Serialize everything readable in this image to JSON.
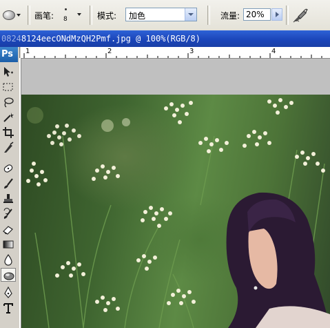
{
  "options_bar": {
    "tool_icon": "blur-tool-icon",
    "brush_label": "画笔:",
    "brush_size": "8",
    "mode_label": "模式:",
    "mode_value": "加色",
    "flow_label": "流量:",
    "flow_value": "20%",
    "airbrush_icon": "airbrush-icon"
  },
  "document": {
    "title_prefix": "0824",
    "title": "8124eecONdMzQH2Pmf.jpg @ 100%(RGB/8)"
  },
  "tools_panel": {
    "logo": "Ps",
    "tools": [
      "move-tool-icon",
      "marquee-tool-icon",
      "lasso-tool-icon",
      "magic-wand-icon",
      "crop-tool-icon",
      "slice-tool-icon",
      "healing-brush-icon",
      "brush-tool-icon",
      "clone-stamp-icon",
      "history-brush-icon",
      "eraser-icon",
      "gradient-icon",
      "blur-tool-icon",
      "dodge-tool-icon",
      "pen-tool-icon",
      "type-tool-icon"
    ]
  },
  "ruler": {
    "labels": [
      "1",
      "2",
      "3",
      "4"
    ]
  },
  "colors": {
    "title_bar": "#1a44b8",
    "chrome": "#d4d0c8",
    "canvas_gray": "#c0c0c0"
  }
}
